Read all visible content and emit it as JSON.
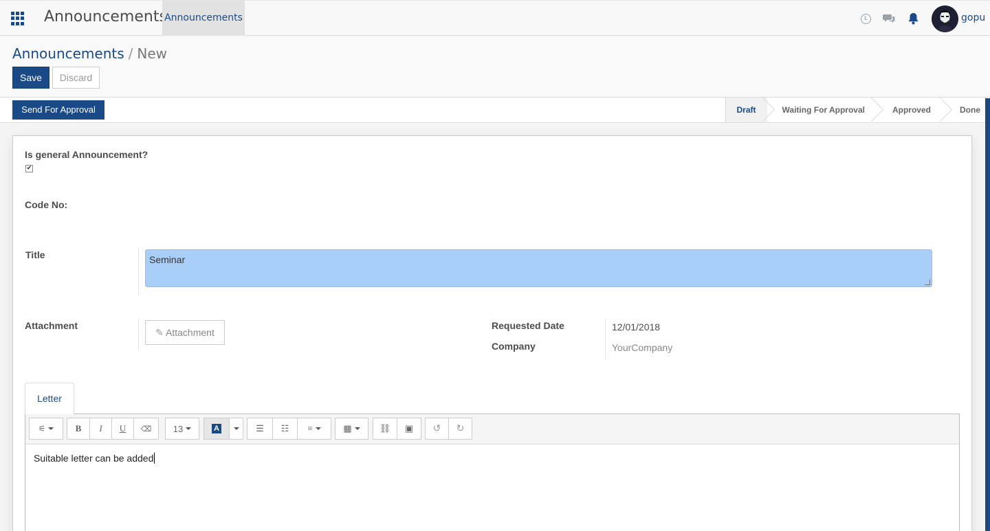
{
  "navbar": {
    "app_title": "Announcements",
    "menu_item": "Announcements",
    "user_name": "gopu"
  },
  "breadcrumb": {
    "parent": "Announcements",
    "separator": "/",
    "current": "New"
  },
  "buttons": {
    "save": "Save",
    "discard": "Discard",
    "send_for_approval": "Send For Approval",
    "attachment": "Attachment"
  },
  "stages": [
    {
      "label": "Draft",
      "active": true
    },
    {
      "label": "Waiting For Approval",
      "active": false
    },
    {
      "label": "Approved",
      "active": false
    },
    {
      "label": "Done",
      "active": false
    }
  ],
  "form": {
    "general_label": "Is general Announcement?",
    "general_checked": true,
    "code_label": "Code No:",
    "title_label": "Title",
    "title_value": "Seminar",
    "attachment_label": "Attachment",
    "requested_date_label": "Requested Date",
    "requested_date_value": "12/01/2018",
    "company_label": "Company",
    "company_value": "YourCompany"
  },
  "notebook": {
    "tab_letter": "Letter",
    "font_size": "13",
    "content": "Suitable letter can be added"
  },
  "colors": {
    "brand": "#1a4a86",
    "title_field_bg": "#a9cff9"
  }
}
